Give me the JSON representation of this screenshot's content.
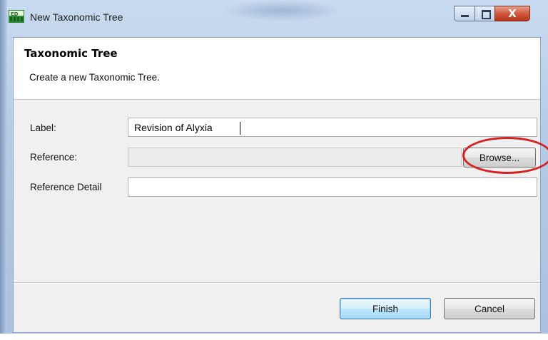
{
  "window": {
    "title": "New Taxonomic Tree",
    "controls": {
      "minimize": "minimize",
      "maximize": "maximize",
      "close": "X"
    }
  },
  "banner": {
    "title": "Taxonomic Tree",
    "description": "Create a new Taxonomic Tree."
  },
  "form": {
    "label_field": {
      "label": "Label:",
      "value": "Revision of Alyxia"
    },
    "reference_field": {
      "label": "Reference:",
      "value": "",
      "browse_label": "Browse..."
    },
    "reference_detail_field": {
      "label": "Reference Detail",
      "value": ""
    }
  },
  "footer": {
    "finish_label": "Finish",
    "cancel_label": "Cancel"
  },
  "annotation": {
    "color": "#d42222",
    "shape": "ellipse around browse button"
  },
  "colors": {
    "accent": "#3c7fb1",
    "close_button": "#c8452a",
    "frame": "#b5cbe6"
  }
}
